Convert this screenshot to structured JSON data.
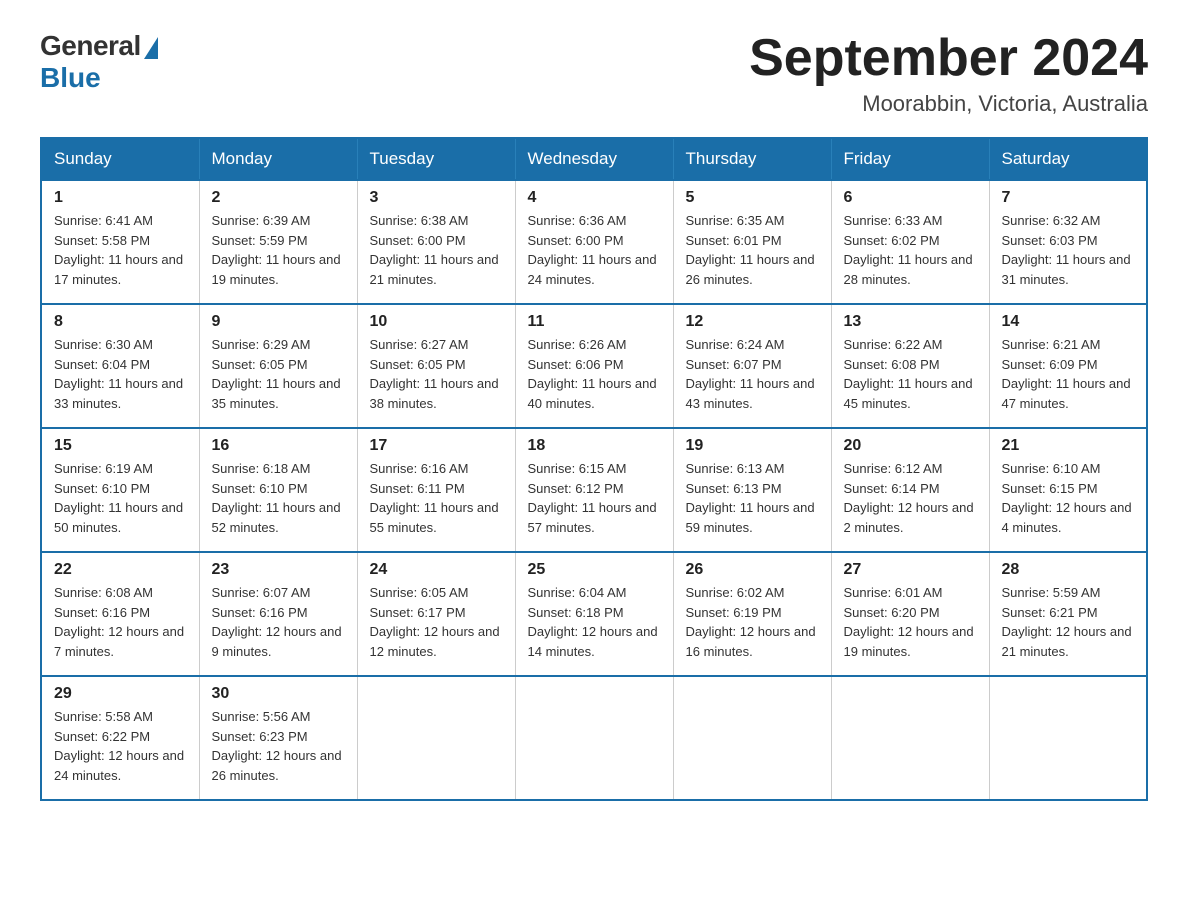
{
  "header": {
    "logo_general": "General",
    "logo_blue": "Blue",
    "month_title": "September 2024",
    "location": "Moorabbin, Victoria, Australia"
  },
  "days_of_week": [
    "Sunday",
    "Monday",
    "Tuesday",
    "Wednesday",
    "Thursday",
    "Friday",
    "Saturday"
  ],
  "weeks": [
    [
      {
        "day": "1",
        "sunrise": "6:41 AM",
        "sunset": "5:58 PM",
        "daylight": "11 hours and 17 minutes."
      },
      {
        "day": "2",
        "sunrise": "6:39 AM",
        "sunset": "5:59 PM",
        "daylight": "11 hours and 19 minutes."
      },
      {
        "day": "3",
        "sunrise": "6:38 AM",
        "sunset": "6:00 PM",
        "daylight": "11 hours and 21 minutes."
      },
      {
        "day": "4",
        "sunrise": "6:36 AM",
        "sunset": "6:00 PM",
        "daylight": "11 hours and 24 minutes."
      },
      {
        "day": "5",
        "sunrise": "6:35 AM",
        "sunset": "6:01 PM",
        "daylight": "11 hours and 26 minutes."
      },
      {
        "day": "6",
        "sunrise": "6:33 AM",
        "sunset": "6:02 PM",
        "daylight": "11 hours and 28 minutes."
      },
      {
        "day": "7",
        "sunrise": "6:32 AM",
        "sunset": "6:03 PM",
        "daylight": "11 hours and 31 minutes."
      }
    ],
    [
      {
        "day": "8",
        "sunrise": "6:30 AM",
        "sunset": "6:04 PM",
        "daylight": "11 hours and 33 minutes."
      },
      {
        "day": "9",
        "sunrise": "6:29 AM",
        "sunset": "6:05 PM",
        "daylight": "11 hours and 35 minutes."
      },
      {
        "day": "10",
        "sunrise": "6:27 AM",
        "sunset": "6:05 PM",
        "daylight": "11 hours and 38 minutes."
      },
      {
        "day": "11",
        "sunrise": "6:26 AM",
        "sunset": "6:06 PM",
        "daylight": "11 hours and 40 minutes."
      },
      {
        "day": "12",
        "sunrise": "6:24 AM",
        "sunset": "6:07 PM",
        "daylight": "11 hours and 43 minutes."
      },
      {
        "day": "13",
        "sunrise": "6:22 AM",
        "sunset": "6:08 PM",
        "daylight": "11 hours and 45 minutes."
      },
      {
        "day": "14",
        "sunrise": "6:21 AM",
        "sunset": "6:09 PM",
        "daylight": "11 hours and 47 minutes."
      }
    ],
    [
      {
        "day": "15",
        "sunrise": "6:19 AM",
        "sunset": "6:10 PM",
        "daylight": "11 hours and 50 minutes."
      },
      {
        "day": "16",
        "sunrise": "6:18 AM",
        "sunset": "6:10 PM",
        "daylight": "11 hours and 52 minutes."
      },
      {
        "day": "17",
        "sunrise": "6:16 AM",
        "sunset": "6:11 PM",
        "daylight": "11 hours and 55 minutes."
      },
      {
        "day": "18",
        "sunrise": "6:15 AM",
        "sunset": "6:12 PM",
        "daylight": "11 hours and 57 minutes."
      },
      {
        "day": "19",
        "sunrise": "6:13 AM",
        "sunset": "6:13 PM",
        "daylight": "11 hours and 59 minutes."
      },
      {
        "day": "20",
        "sunrise": "6:12 AM",
        "sunset": "6:14 PM",
        "daylight": "12 hours and 2 minutes."
      },
      {
        "day": "21",
        "sunrise": "6:10 AM",
        "sunset": "6:15 PM",
        "daylight": "12 hours and 4 minutes."
      }
    ],
    [
      {
        "day": "22",
        "sunrise": "6:08 AM",
        "sunset": "6:16 PM",
        "daylight": "12 hours and 7 minutes."
      },
      {
        "day": "23",
        "sunrise": "6:07 AM",
        "sunset": "6:16 PM",
        "daylight": "12 hours and 9 minutes."
      },
      {
        "day": "24",
        "sunrise": "6:05 AM",
        "sunset": "6:17 PM",
        "daylight": "12 hours and 12 minutes."
      },
      {
        "day": "25",
        "sunrise": "6:04 AM",
        "sunset": "6:18 PM",
        "daylight": "12 hours and 14 minutes."
      },
      {
        "day": "26",
        "sunrise": "6:02 AM",
        "sunset": "6:19 PM",
        "daylight": "12 hours and 16 minutes."
      },
      {
        "day": "27",
        "sunrise": "6:01 AM",
        "sunset": "6:20 PM",
        "daylight": "12 hours and 19 minutes."
      },
      {
        "day": "28",
        "sunrise": "5:59 AM",
        "sunset": "6:21 PM",
        "daylight": "12 hours and 21 minutes."
      }
    ],
    [
      {
        "day": "29",
        "sunrise": "5:58 AM",
        "sunset": "6:22 PM",
        "daylight": "12 hours and 24 minutes."
      },
      {
        "day": "30",
        "sunrise": "5:56 AM",
        "sunset": "6:23 PM",
        "daylight": "12 hours and 26 minutes."
      },
      null,
      null,
      null,
      null,
      null
    ]
  ],
  "labels": {
    "sunrise": "Sunrise:",
    "sunset": "Sunset:",
    "daylight": "Daylight:"
  }
}
